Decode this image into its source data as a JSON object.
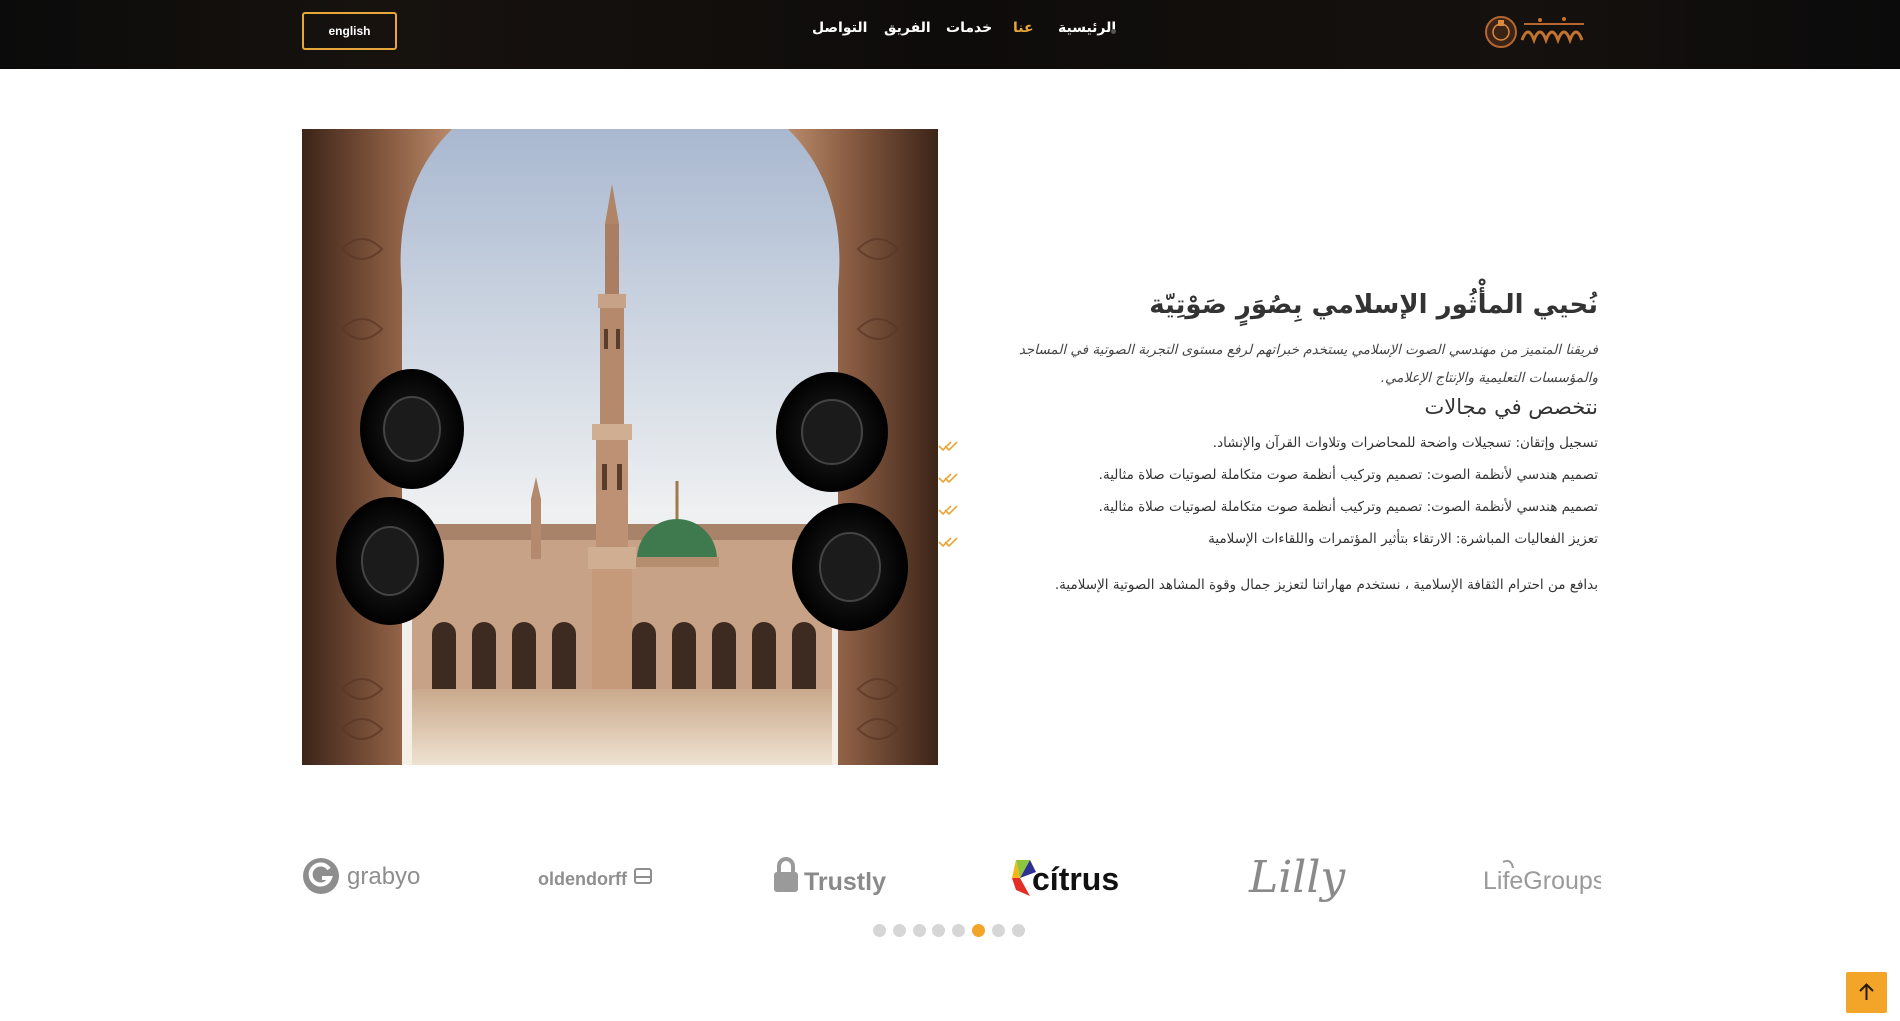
{
  "header": {
    "language_button": "english",
    "nav": [
      {
        "label": "الرئيسية",
        "active": false
      },
      {
        "label": "عنا",
        "active": true
      },
      {
        "label": "خدمات",
        "active": false
      },
      {
        "label": "الفريق",
        "active": false
      },
      {
        "label": "التواصل",
        "active": false
      }
    ],
    "logo_icon": "sound-wave-mosque-logo"
  },
  "hero": {
    "image": "mosque-minaret-with-speakers-photo"
  },
  "content": {
    "title": "نُحيي المأْثُور الإسلامي بِصُوَرٍ صَوْتِيّة",
    "lead": "فريقنا المتميز من مهندسي الصوت الإسلامي يستخدم خبراتهم لرفع مستوى التجربة الصوتية في المساجد والمؤسسات التعليمية والإنتاج الإعلامي.",
    "subtitle": "نتخصص في مجالات",
    "features": [
      "تسجيل وإتقان: تسجيلات واضحة للمحاضرات وتلاوات القرآن والإنشاد.",
      "تصميم هندسي لأنظمة الصوت: تصميم وتركيب أنظمة صوت متكاملة لصوتيات صلاة مثالية.",
      "تصميم هندسي لأنظمة الصوت: تصميم وتركيب أنظمة صوت متكاملة لصوتيات صلاة مثالية.",
      "تعزيز الفعاليات المباشرة: الارتقاء بتأثير المؤتمرات واللقاءات الإسلامية"
    ],
    "closing": "بدافع من احترام الثقافة الإسلامية ، نستخدم مهاراتنا لتعزيز جمال وقوة المشاهد الصوتية الإسلامية."
  },
  "brands": [
    "grabyo",
    "oldendorff",
    "Trustly",
    "cítrus",
    "Lilly",
    "LifeGroups"
  ],
  "carousel": {
    "count": 8,
    "active_index": 5
  },
  "colors": {
    "accent": "#f3a52a",
    "header_bg": "#0f0d0c",
    "text": "#333333"
  }
}
